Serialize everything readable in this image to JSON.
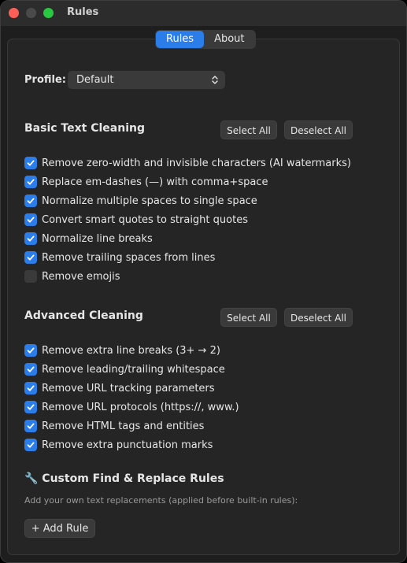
{
  "window": {
    "title": "Rules"
  },
  "tabs": [
    {
      "label": "Rules",
      "active": true
    },
    {
      "label": "About",
      "active": false
    }
  ],
  "profile": {
    "label": "Profile:",
    "selected": "Default"
  },
  "basic": {
    "title": "Basic Text Cleaning",
    "select_all": "Select All",
    "deselect_all": "Deselect All",
    "items": [
      {
        "label": "Remove zero-width and invisible characters (AI watermarks)",
        "checked": true
      },
      {
        "label": "Replace em-dashes (—) with comma+space",
        "checked": true
      },
      {
        "label": "Normalize multiple spaces to single space",
        "checked": true
      },
      {
        "label": "Convert smart quotes to straight quotes",
        "checked": true
      },
      {
        "label": "Normalize line breaks",
        "checked": true
      },
      {
        "label": "Remove trailing spaces from lines",
        "checked": true
      },
      {
        "label": "Remove emojis",
        "checked": false
      }
    ]
  },
  "advanced": {
    "title": "Advanced Cleaning",
    "select_all": "Select All",
    "deselect_all": "Deselect All",
    "items": [
      {
        "label": "Remove extra line breaks (3+ → 2)",
        "checked": true
      },
      {
        "label": "Remove leading/trailing whitespace",
        "checked": true
      },
      {
        "label": "Remove URL tracking parameters",
        "checked": true
      },
      {
        "label": "Remove URL protocols (https://, www.)",
        "checked": true
      },
      {
        "label": "Remove HTML tags and entities",
        "checked": true
      },
      {
        "label": "Remove extra punctuation marks",
        "checked": true
      }
    ]
  },
  "custom": {
    "title": "🔧 Custom Find & Replace Rules",
    "hint": "Add your own text replacements (applied before built-in rules):",
    "add_button": "+ Add Rule"
  },
  "colors": {
    "accent": "#2b7de9",
    "background": "#1e1e1e",
    "close": "#ff5f57",
    "maximize": "#28c840"
  }
}
